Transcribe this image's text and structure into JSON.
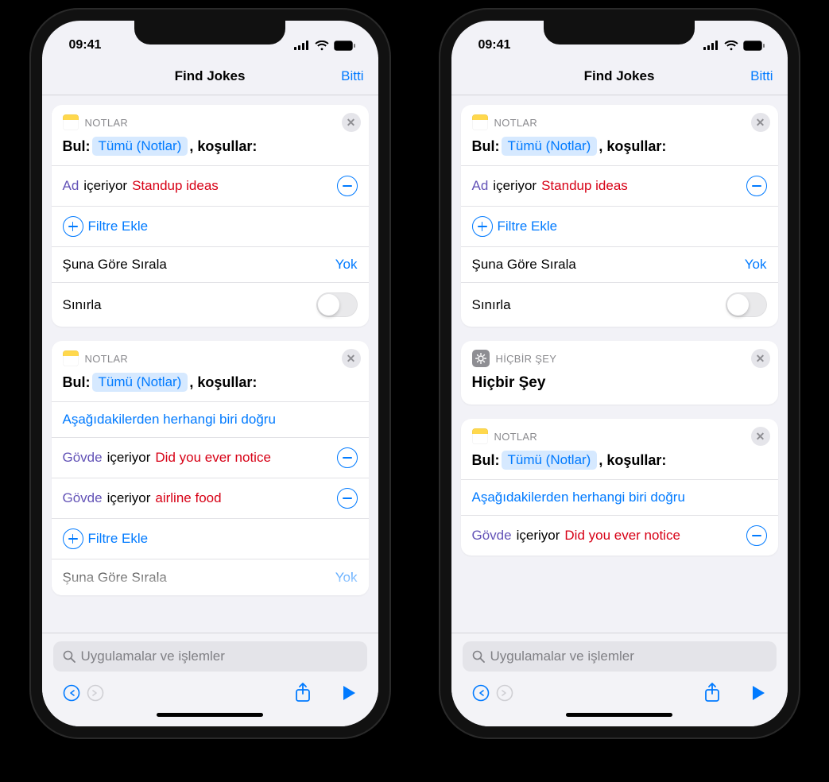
{
  "status": {
    "time": "09:41"
  },
  "nav": {
    "title": "Find Jokes",
    "done": "Bitti"
  },
  "labels": {
    "notes_header": "NOTLAR",
    "nothing_header": "HİÇBİR ŞEY",
    "find_prefix": "Bul:",
    "find_folder": "Tümü (Notlar)",
    "find_suffix": ", koşullar:",
    "name_field": "Ad",
    "body_field": "Gövde",
    "contains": "içeriyor",
    "add_filter": "Filtre Ekle",
    "sort_by": "Şuna Göre Sırala",
    "sort_value": "Yok",
    "limit": "Sınırla",
    "any_true": "Aşağıdakilerden herhangi biri doğru",
    "nothing_body": "Hiçbir Şey"
  },
  "values": {
    "standup": "Standup ideas",
    "notice": "Did you ever notice",
    "airline": "airline food"
  },
  "search": {
    "placeholder": "Uygulamalar ve işlemler"
  }
}
